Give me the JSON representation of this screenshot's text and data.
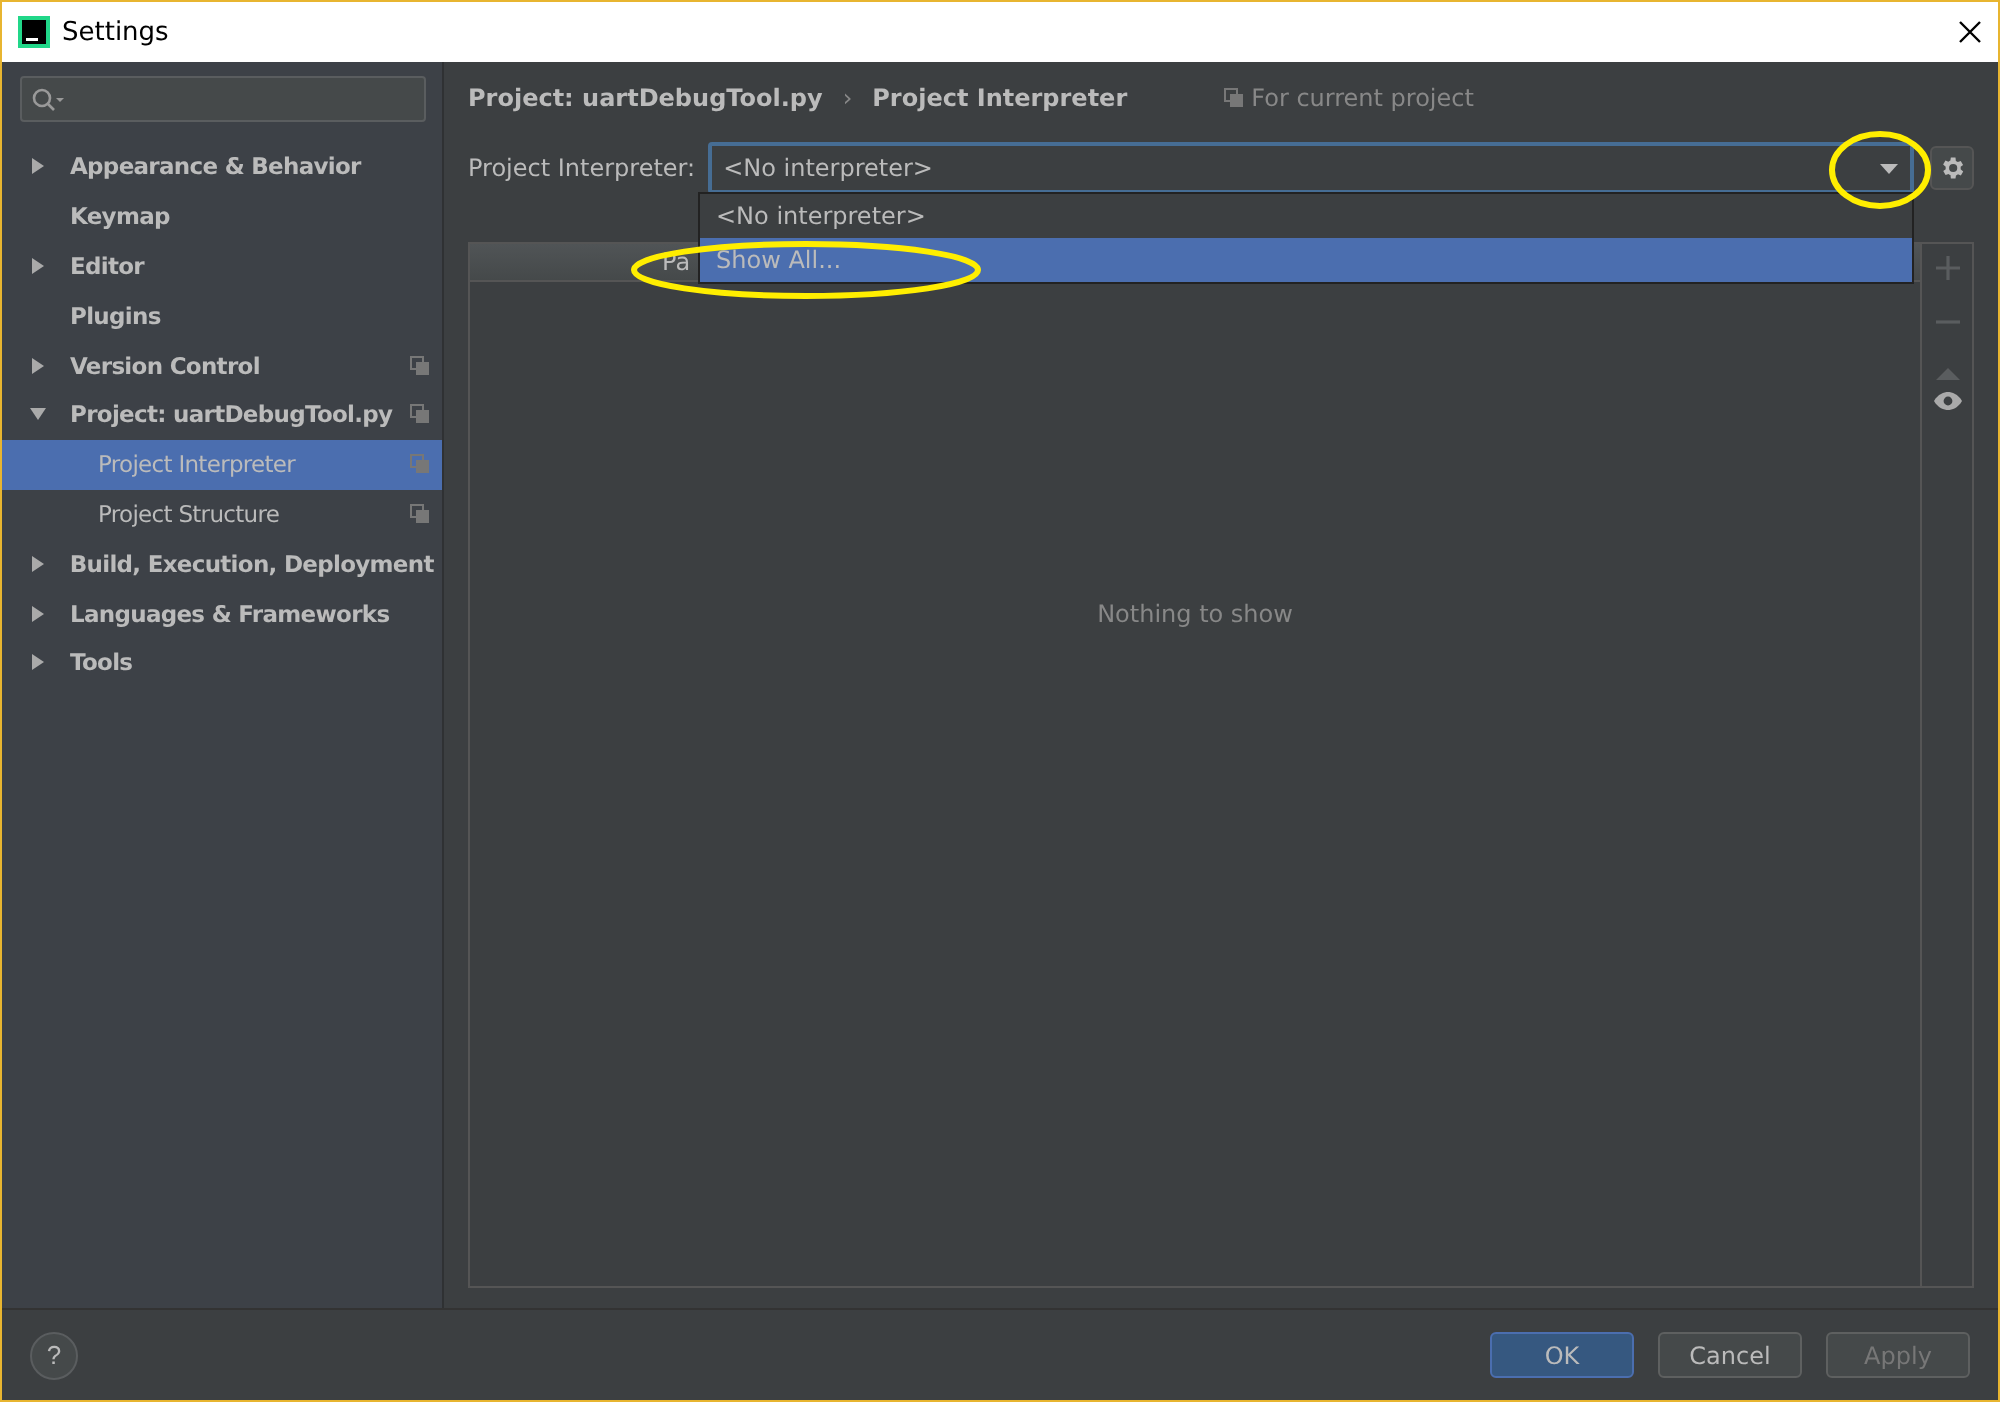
{
  "window": {
    "title": "Settings"
  },
  "sidebar": {
    "items": [
      {
        "label": "Appearance & Behavior",
        "expanded": false,
        "selected": false,
        "project_scoped": false
      },
      {
        "label": "Keymap",
        "selected": false,
        "project_scoped": false
      },
      {
        "label": "Editor",
        "expanded": false,
        "selected": false,
        "project_scoped": false
      },
      {
        "label": "Plugins",
        "selected": false,
        "project_scoped": false
      },
      {
        "label": "Version Control",
        "expanded": false,
        "selected": false,
        "project_scoped": true
      },
      {
        "label": "Project: uartDebugTool.py",
        "expanded": true,
        "selected": false,
        "project_scoped": true,
        "children": [
          {
            "label": "Project Interpreter",
            "selected": true,
            "project_scoped": true
          },
          {
            "label": "Project Structure",
            "selected": false,
            "project_scoped": true
          }
        ]
      },
      {
        "label": "Build, Execution, Deployment",
        "expanded": false,
        "selected": false,
        "project_scoped": false
      },
      {
        "label": "Languages & Frameworks",
        "expanded": false,
        "selected": false,
        "project_scoped": false
      },
      {
        "label": "Tools",
        "expanded": false,
        "selected": false,
        "project_scoped": false
      }
    ]
  },
  "breadcrumb": {
    "items": [
      "Project: uartDebugTool.py",
      "Project Interpreter"
    ],
    "separator": "›"
  },
  "scope_note": "For current project",
  "interpreter": {
    "label": "Project Interpreter:",
    "value": "<No interpreter>",
    "options": [
      {
        "label": "<No interpreter>",
        "highlighted": false
      },
      {
        "label": "Show All...",
        "highlighted": true
      }
    ]
  },
  "table": {
    "columns": [
      "Pa"
    ],
    "empty_text": "Nothing to show"
  },
  "footer": {
    "help": "?",
    "buttons": [
      {
        "label": "OK",
        "kind": "primary",
        "disabled": false
      },
      {
        "label": "Cancel",
        "kind": "normal",
        "disabled": false
      },
      {
        "label": "Apply",
        "kind": "normal",
        "disabled": true
      }
    ]
  }
}
